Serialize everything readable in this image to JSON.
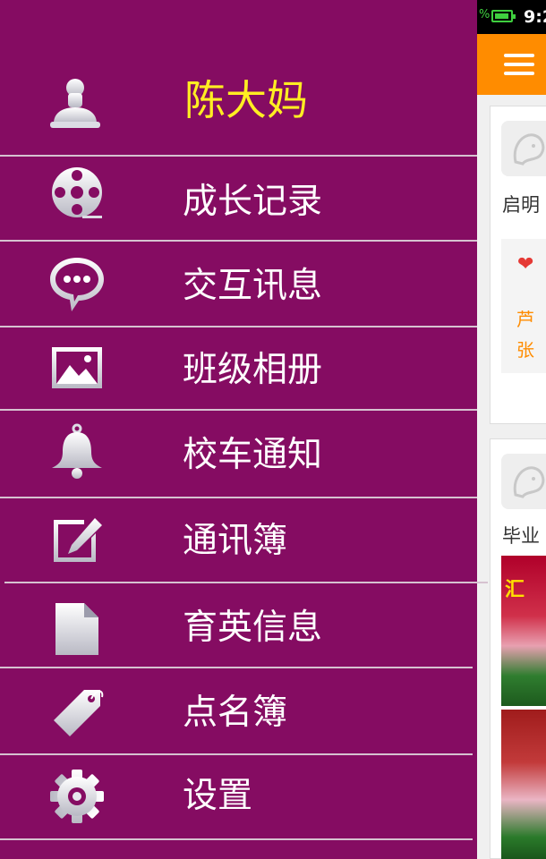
{
  "status_bar": {
    "time": "9:2"
  },
  "background_feed": {
    "card1": {
      "title": "启明",
      "likers": [
        "芦",
        "张"
      ]
    },
    "card2": {
      "title": "毕业",
      "photo_text": "汇 "
    }
  },
  "user": {
    "name": "陈大妈"
  },
  "menu": [
    {
      "id": "growth",
      "label": "成长记录",
      "icon": "film-reel-icon"
    },
    {
      "id": "messages",
      "label": "交互讯息",
      "icon": "chat-bubble-icon"
    },
    {
      "id": "album",
      "label": "班级相册",
      "icon": "picture-icon"
    },
    {
      "id": "bus",
      "label": "校车通知",
      "icon": "bell-icon"
    },
    {
      "id": "contacts",
      "label": "通讯簿",
      "icon": "edit-icon"
    },
    {
      "id": "news",
      "label": "育英信息",
      "icon": "document-icon"
    },
    {
      "id": "rollcall",
      "label": "点名簿",
      "icon": "tag-icon"
    },
    {
      "id": "settings",
      "label": "设置",
      "icon": "gear-icon"
    }
  ],
  "colors": {
    "drawer_bg": "#850c62",
    "user_name": "#ffee22",
    "header_bar": "#ff8c00"
  }
}
